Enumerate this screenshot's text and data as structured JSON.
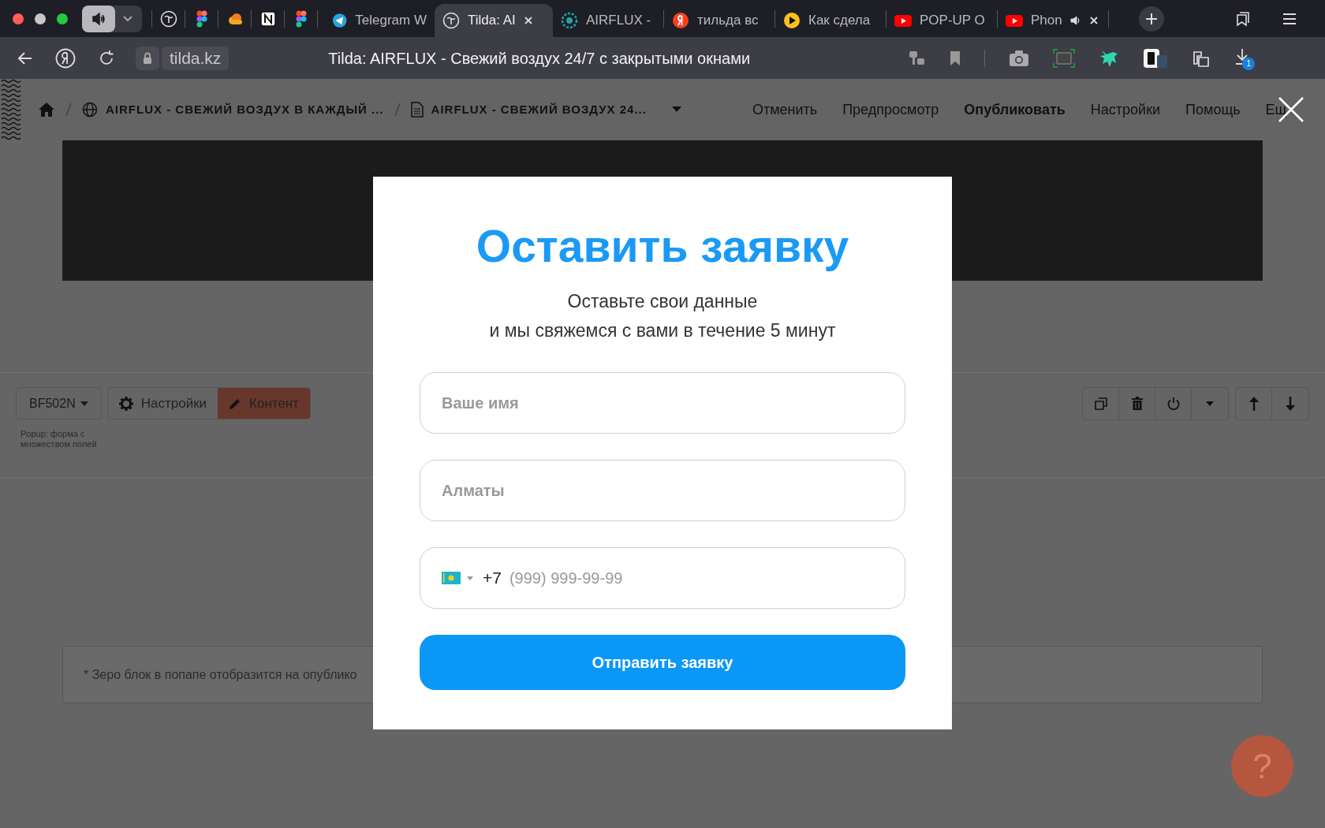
{
  "browser": {
    "tabs": [
      {
        "kind": "telegram",
        "label": "Telegram W",
        "selected": false,
        "playing_audio": false
      },
      {
        "kind": "tilda",
        "label": "Tilda: AI",
        "selected": true,
        "playing_audio": false
      },
      {
        "kind": "airflux",
        "label": "AIRFLUX -",
        "selected": false,
        "playing_audio": false
      },
      {
        "kind": "yandex",
        "label": "тильда вс",
        "selected": false,
        "playing_audio": false
      },
      {
        "kind": "play",
        "label": "Как сдела",
        "selected": false,
        "playing_audio": false
      },
      {
        "kind": "youtube",
        "label": "POP-UP O",
        "selected": false,
        "playing_audio": false
      },
      {
        "kind": "youtube",
        "label": "Phon",
        "selected": false,
        "playing_audio": true
      }
    ],
    "address": "tilda.kz",
    "page_title": "Tilda: AIRFLUX - Свежий воздух 24/7 с закрытыми окнами",
    "downloads_badge": "1"
  },
  "editor": {
    "breadcrumbs": [
      {
        "kind": "project",
        "label": "AIRFLUX - СВЕЖИЙ ВОЗДУХ В КАЖДЫЙ ..."
      },
      {
        "kind": "page",
        "label": "AIRFLUX - СВЕЖИЙ ВОЗДУХ 24..."
      }
    ],
    "menu": [
      {
        "label": "Отменить",
        "primary": false
      },
      {
        "label": "Предпросмотр",
        "primary": false
      },
      {
        "label": "Опубликовать",
        "primary": true
      },
      {
        "label": "Настройки",
        "primary": false
      },
      {
        "label": "Помощь",
        "primary": false
      },
      {
        "label": "Ещ",
        "primary": false
      }
    ],
    "block": {
      "id": "BF502N",
      "buttons": [
        {
          "kind": "settings",
          "label": "Настройки",
          "selected": false
        },
        {
          "kind": "content",
          "label": "Контент",
          "selected": true
        }
      ],
      "caption": "Popup: форма с множеством полей"
    },
    "notice": "* Зеро блок в попапе отобразится на опублико",
    "help": "?"
  },
  "popup": {
    "title": "Оставить заявку",
    "subtitle_lines": [
      "Оставьте свои данные",
      "и мы свяжемся с вами в течение 5 минут"
    ],
    "fields": [
      {
        "kind": "text",
        "placeholder": "Ваше имя"
      },
      {
        "kind": "text",
        "placeholder": "Алматы"
      },
      {
        "kind": "phone",
        "prefix": "+7",
        "placeholder": "(999) 999-99-99"
      }
    ],
    "submit": "Отправить заявку"
  }
}
